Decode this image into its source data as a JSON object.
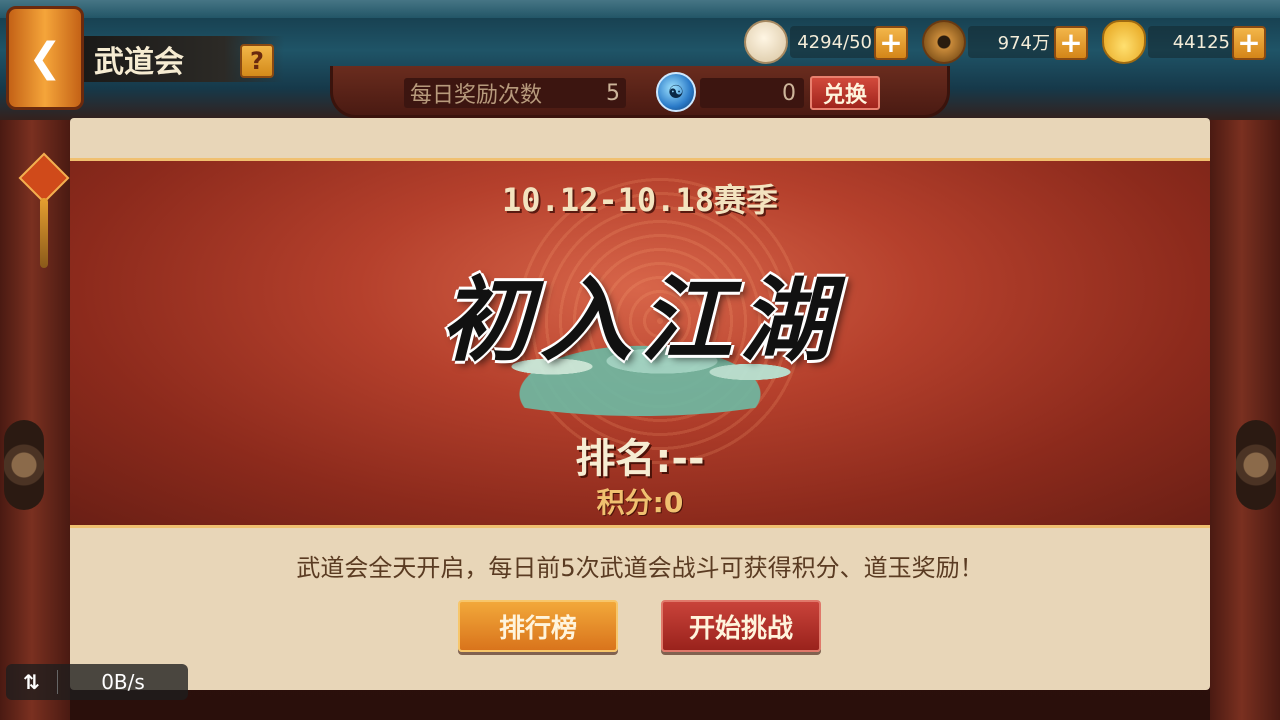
{
  "header": {
    "back_symbol": "❮",
    "title": "武道会",
    "help_symbol": "?"
  },
  "resources": {
    "stamina": {
      "icon": "steamed-bun-icon",
      "value": "4294/50"
    },
    "copper": {
      "icon": "copper-coin-icon",
      "value": "974万"
    },
    "gold": {
      "icon": "gold-ingot-icon",
      "value": "44125"
    },
    "plus_symbol": "+"
  },
  "daily": {
    "label": "每日奖励次数",
    "count": "5",
    "jade_icon": "taiji-jade-icon",
    "jade_count": "0",
    "exchange_label": "兑换"
  },
  "season": {
    "title": "10.12-10.18赛季",
    "tier_name": "初入江湖",
    "rank_text": "排名:--",
    "score_text": "积分:0"
  },
  "description": "武道会全天开启，每日前5次武道会战斗可获得积分、道玉奖励！",
  "buttons": {
    "leaderboard": "排行榜",
    "start": "开始挑战"
  },
  "network": {
    "arrows": "⇅",
    "speed": "0B/s"
  },
  "colors": {
    "accent_gold": "#f0c070",
    "panel_bg": "#e8d6b8",
    "season_red": "#b5402c",
    "button_orange": "#e08a28",
    "button_red": "#b8322a"
  }
}
